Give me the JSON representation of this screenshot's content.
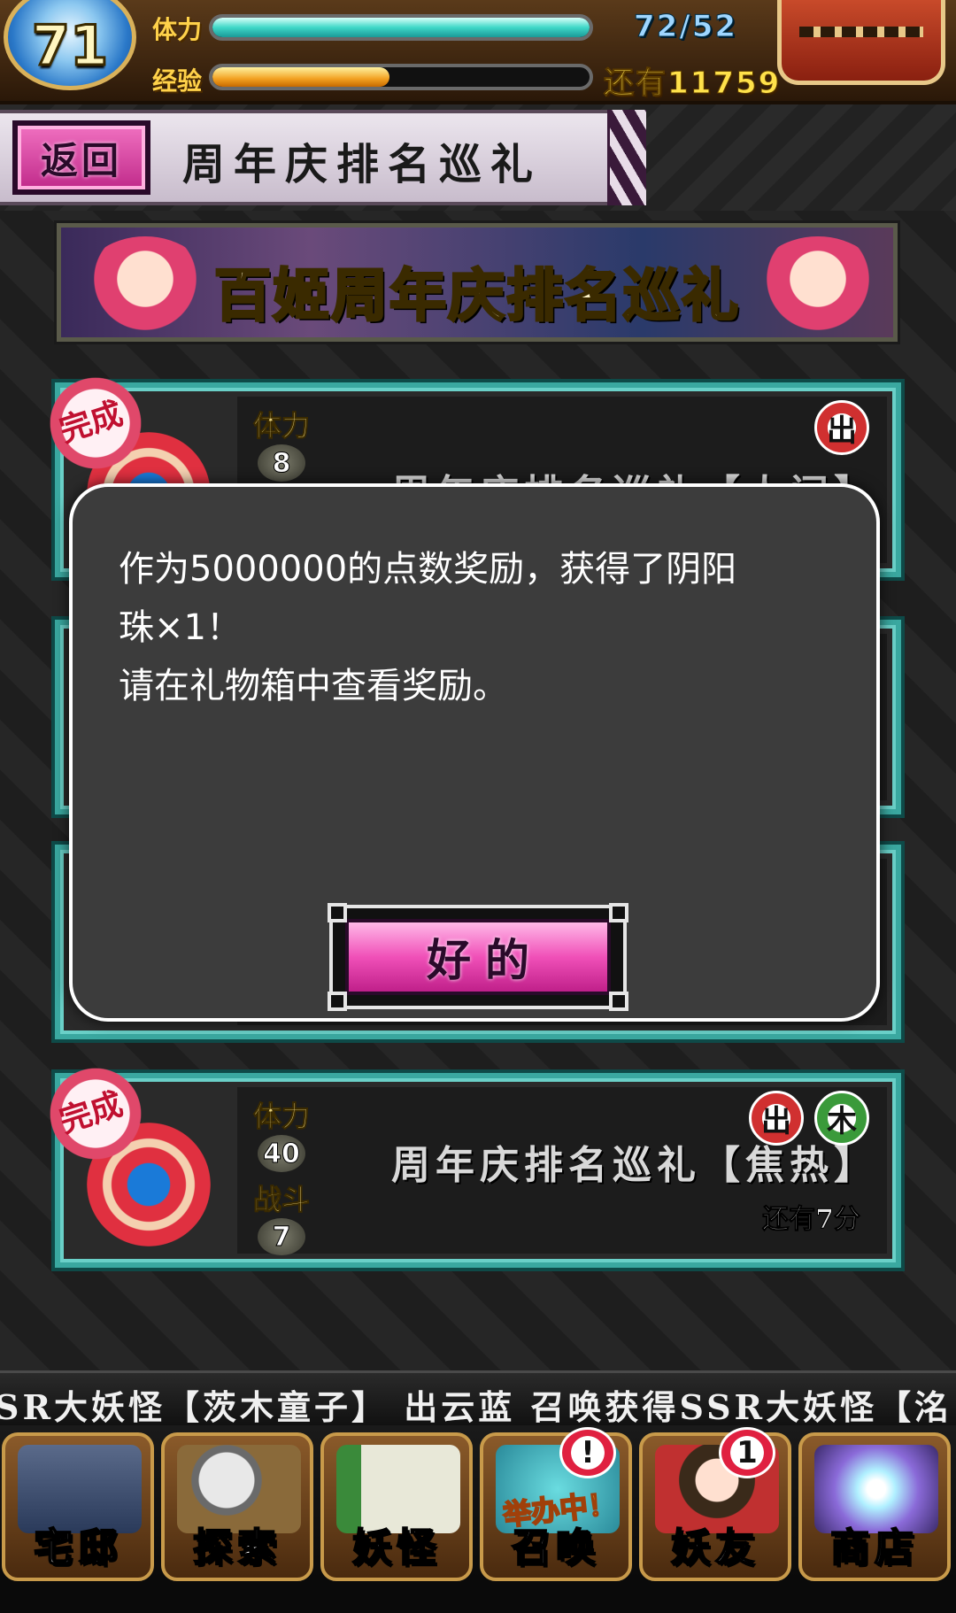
{
  "status": {
    "level": "71",
    "stamina_label": "体力",
    "stamina_value": "72/52",
    "stamina_fraction": 1.0,
    "exp_label": "经验",
    "exp_fraction": 0.47,
    "exp_remaining": "还有11759"
  },
  "header": {
    "back_label": "返回",
    "page_title": "周年庆排名巡礼"
  },
  "banner": {
    "title": "百姬周年庆排名巡礼"
  },
  "quests": [
    {
      "complete_label": "完成",
      "costs": [
        {
          "label": "体力",
          "value": "8"
        }
      ],
      "name": "周年庆排名巡礼【人间】",
      "badges": [
        "出"
      ]
    },
    {
      "complete_label": "完成",
      "costs": [
        {
          "label": "体力",
          "value": "40"
        },
        {
          "label": "战斗",
          "value": "7"
        }
      ],
      "name": "周年庆排名巡礼【焦热】",
      "badges": [
        "出",
        "木"
      ],
      "time_left": "还有7分"
    }
  ],
  "dialog": {
    "line1": "作为5000000的点数奖励，获得了阴阳",
    "line2": "珠×1！",
    "line3": "请在礼物箱中查看奖励。",
    "ok_label": "好的"
  },
  "ticker": {
    "text": "SR大妖怪【茨木童子】    出云蓝 召唤获得SSR大妖怪【洺"
  },
  "nav": {
    "items": [
      {
        "label": "宅邸",
        "icon": "mansion-icon"
      },
      {
        "label": "探索",
        "icon": "magnifier-map-icon"
      },
      {
        "label": "妖怪",
        "icon": "yokai-scroll-icon"
      },
      {
        "label": "召唤",
        "icon": "summon-icon",
        "alert": "!",
        "event": "举办中！"
      },
      {
        "label": "妖友",
        "icon": "fox-girl-icon",
        "alert": "1"
      },
      {
        "label": "商店",
        "icon": "crystal-orb-icon"
      }
    ]
  },
  "colors": {
    "accent_pink": "#f050b8",
    "card_teal": "#3aa8a0",
    "dialog_bg": "#3c3c3c"
  }
}
